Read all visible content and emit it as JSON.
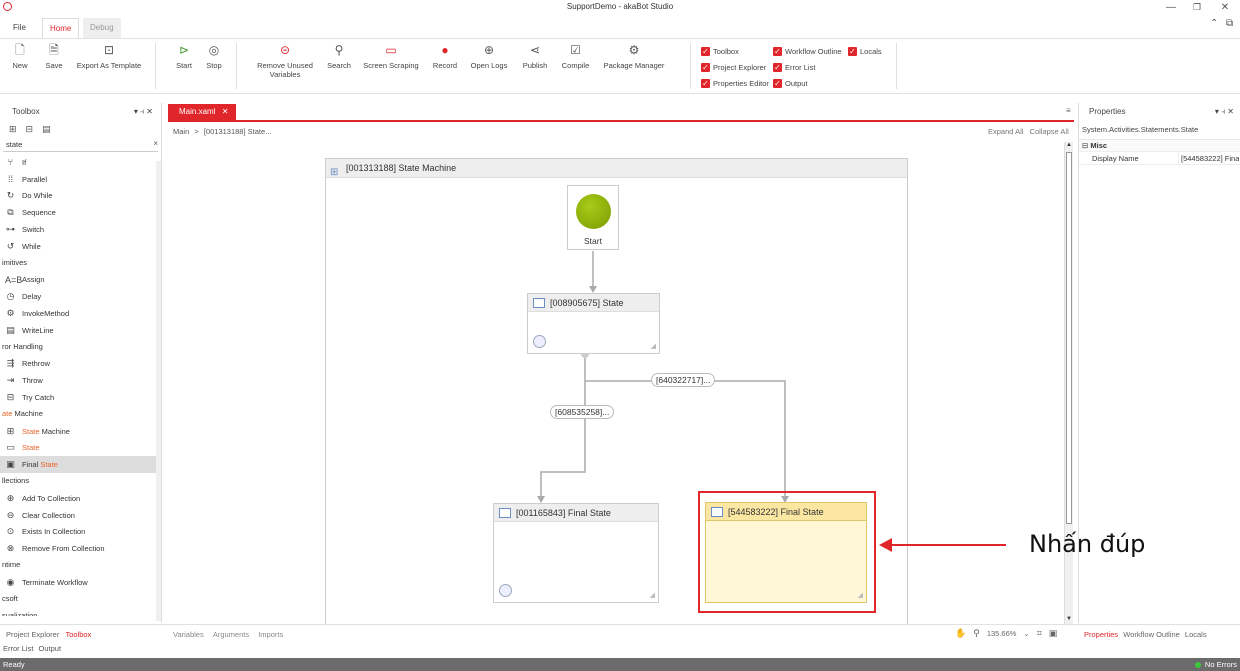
{
  "window": {
    "title": "SupportDemo - akaBot Studio"
  },
  "menu_tabs": [
    {
      "label": "File"
    },
    {
      "label": "Home"
    },
    {
      "label": "Debug"
    }
  ],
  "ribbon": {
    "new": "New",
    "save": "Save",
    "export": "Export As Template",
    "start": "Start",
    "stop": "Stop",
    "remove_unused_1": "Remove Unused",
    "remove_unused_2": "Variables",
    "search": "Search",
    "screen_scraping": "Screen Scraping",
    "record": "Record",
    "open_logs": "Open Logs",
    "publish": "Publish",
    "compile": "Compile",
    "package_manager": "Package Manager",
    "checks": {
      "toolbox": "Toolbox",
      "workflow_outline": "Workflow Outline",
      "locals": "Locals",
      "project_explorer": "Project Explorer",
      "error_list": "Error List",
      "properties_editor": "Properties Editor",
      "output": "Output"
    }
  },
  "toolbox": {
    "title": "Toolbox",
    "search_value": "state",
    "items": [
      {
        "type": "item",
        "icon": "if-icon",
        "glyph": "⑂",
        "label": "If"
      },
      {
        "type": "item",
        "icon": "parallel-icon",
        "glyph": "⁞⁞",
        "label": "Parallel"
      },
      {
        "type": "item",
        "icon": "do-while-icon",
        "glyph": "↻",
        "label": "Do While"
      },
      {
        "type": "item",
        "icon": "sequence-icon",
        "glyph": "⧉",
        "label": "Sequence"
      },
      {
        "type": "item",
        "icon": "switch-icon",
        "glyph": "⊶",
        "label": "Switch"
      },
      {
        "type": "item",
        "icon": "while-icon",
        "glyph": "↺",
        "label": "While"
      },
      {
        "type": "cat",
        "label": "imitives"
      },
      {
        "type": "item",
        "icon": "assign-icon",
        "glyph": "A=B",
        "label": "Assign"
      },
      {
        "type": "item",
        "icon": "delay-icon",
        "glyph": "◷",
        "label": "Delay"
      },
      {
        "type": "item",
        "icon": "invoke-method-icon",
        "glyph": "⚙",
        "label": "InvokeMethod"
      },
      {
        "type": "item",
        "icon": "writeline-icon",
        "glyph": "▤",
        "label": "WriteLine"
      },
      {
        "type": "cat",
        "label": "ror Handling"
      },
      {
        "type": "item",
        "icon": "rethrow-icon",
        "glyph": "⇶",
        "label": "Rethrow"
      },
      {
        "type": "item",
        "icon": "throw-icon",
        "glyph": "⇥",
        "label": "Throw"
      },
      {
        "type": "item",
        "icon": "try-catch-icon",
        "glyph": "⊟",
        "label": "Try Catch"
      },
      {
        "type": "cat",
        "label_pre": "",
        "label_hl": "ate",
        "label_post": " Machine"
      },
      {
        "type": "item",
        "icon": "state-machine-icon",
        "glyph": "⊞",
        "label_pre": "",
        "label_hl": "State",
        "label_post": " Machine"
      },
      {
        "type": "item",
        "icon": "state-icon",
        "glyph": "▭",
        "label_pre": "",
        "label_hl": "State",
        "label_post": ""
      },
      {
        "type": "item",
        "icon": "final-state-icon",
        "glyph": "▣",
        "label_pre": "Final ",
        "label_hl": "State",
        "label_post": "",
        "selected": true
      },
      {
        "type": "cat",
        "label": "llections"
      },
      {
        "type": "item",
        "icon": "add-to-collection-icon",
        "glyph": "⊕",
        "label": "Add To Collection"
      },
      {
        "type": "item",
        "icon": "clear-collection-icon",
        "glyph": "⊖",
        "label": "Clear Collection"
      },
      {
        "type": "item",
        "icon": "exists-in-collection-icon",
        "glyph": "⊙",
        "label": "Exists In Collection"
      },
      {
        "type": "item",
        "icon": "remove-from-collection-icon",
        "glyph": "⊗",
        "label": "Remove From Collection"
      },
      {
        "type": "cat",
        "label": "ntime"
      },
      {
        "type": "item",
        "icon": "terminate-workflow-icon",
        "glyph": "◉",
        "label": "Terminate Workflow"
      },
      {
        "type": "cat",
        "label": "csoft"
      },
      {
        "type": "cat",
        "label": "sualization"
      }
    ]
  },
  "designer": {
    "tab": "Main.xaml",
    "breadcrumb_root": "Main",
    "breadcrumb_sep": ">",
    "breadcrumb_item": "[001313188] State...",
    "expand_all": "Expand All",
    "collapse_all": "Collapse All",
    "state_machine_title": "[001313188] State Machine",
    "start_label": "Start",
    "state1_title": "[008905675] State",
    "final1_title": "[001165843] Final State",
    "final2_title": "[544583222] Final State",
    "trans1": "[640322717]...",
    "trans2": "[608535258]...",
    "annotation": "Nhấn đúp",
    "bottom_tabs": [
      "Variables",
      "Arguments",
      "Imports"
    ],
    "zoom": "135.66%"
  },
  "properties": {
    "title": "Properties",
    "type_name": "System.Activities.Statements.State",
    "category": "Misc",
    "rows": [
      {
        "name": "Display Name",
        "value": "[544583222] Fina"
      }
    ],
    "bottom_tabs": [
      "Properties",
      "Workflow Outline",
      "Locals"
    ]
  },
  "left_bottom_tabs": [
    "Project Explorer",
    "Toolbox"
  ],
  "bottom_panel_tabs": [
    "Error List",
    "Output"
  ],
  "status": {
    "left": "Ready",
    "right": "No Errors"
  },
  "colors": {
    "accent": "#e0262b",
    "highlight": "#e8632c",
    "start_circle": "#8fb300",
    "selected_state": "#fff7d6"
  }
}
